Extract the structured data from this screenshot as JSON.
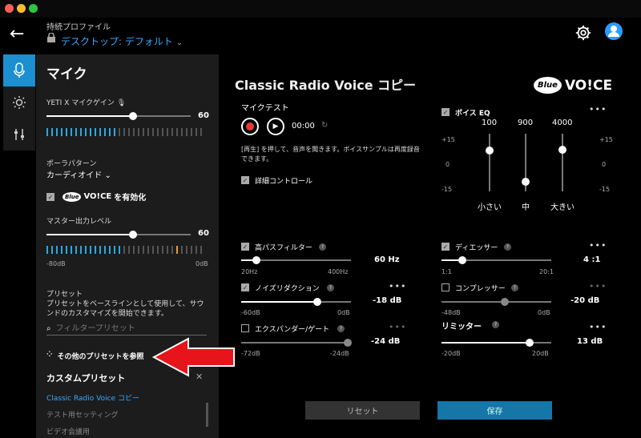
{
  "window": {
    "controls": [
      "close",
      "minimize",
      "zoom"
    ]
  },
  "header": {
    "profile_caption": "持続プロファイル",
    "profile_name": "デスクトップ: デフォルト"
  },
  "panel": {
    "title": "マイク",
    "gain_label": "YETI X マイクゲイン",
    "gain_value": "60",
    "polar_label": "ポーラパターン",
    "polar_value": "カーディオイド",
    "voice_enable_label": "を有効化",
    "voice_logo": "Blue VO!CE",
    "master_label": "マスター出力レベル",
    "master_value": "60",
    "master_min": "-80dB",
    "master_max": "0dB",
    "preset_label": "プリセット",
    "preset_desc": "プリセットをベースラインとして使用して、サウンドのカスタマイズを開始できます。",
    "filter_placeholder": "フィルタープリセット",
    "browse_label": "その他のプリセットを参照",
    "custom_header": "カスタムプリセット",
    "custom_items": [
      "Classic Radio Voice コピー",
      "テスト用セッティング",
      "ビデオ会議用"
    ]
  },
  "main": {
    "title": "Classic Radio Voice コピー",
    "logo_blue": "Blue",
    "logo_voice": "VO!CE",
    "mic_test_label": "マイクテスト",
    "time": "00:00",
    "play_hint": "[再生] を押して、音声を聞きます。ボイスサンプルは再度録音できます。",
    "advanced_label": "詳細コントロール",
    "eq": {
      "label": "ボイス EQ",
      "bands": [
        "100",
        "900",
        "4000"
      ],
      "scale": [
        "+15",
        "0",
        "-15"
      ],
      "bottom": [
        "小さい",
        "中",
        "大きい"
      ]
    },
    "hpf": {
      "label": "高パスフィルター",
      "value": "60",
      "unit": "Hz",
      "min": "20Hz",
      "max": "400Hz"
    },
    "deesser": {
      "label": "ディエッサー",
      "value": "4",
      "unit": ":1",
      "min": "1:1",
      "max": "20:1"
    },
    "nr": {
      "label": "ノイズリダクション",
      "value": "-18",
      "unit": "dB",
      "min": "-60dB",
      "max": "0dB"
    },
    "comp": {
      "label": "コンプレッサー",
      "value": "-20",
      "unit": "dB",
      "min": "-48dB",
      "max": "0dB"
    },
    "exp": {
      "label": "エクスパンダー/ゲート",
      "value": "-24",
      "unit": "dB",
      "min": "-72dB",
      "max": "-24dB"
    },
    "limiter": {
      "label": "リミッター",
      "value": "13",
      "unit": "dB",
      "min": "-20dB",
      "max": "20dB"
    },
    "reset_label": "リセット",
    "save_label": "保存"
  },
  "colors": {
    "accent": "#2ca7e0",
    "save": "#1576a8",
    "record": "#e53935",
    "arrow": "#e8141b"
  }
}
